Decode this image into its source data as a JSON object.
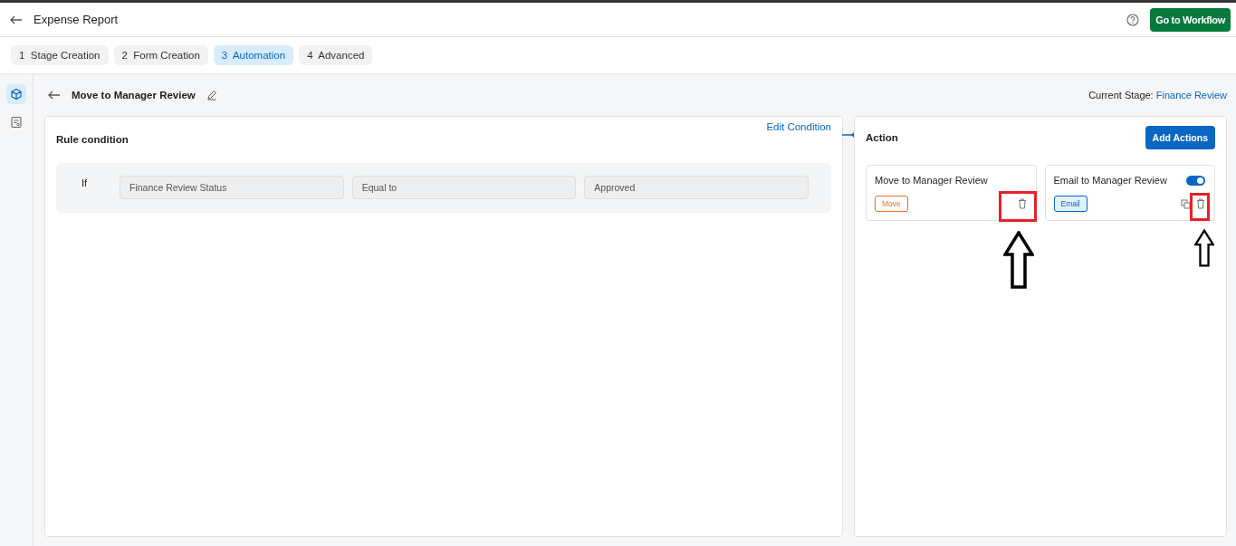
{
  "header": {
    "title": "Expense Report",
    "primary_button": "Go to Workflow"
  },
  "steps": [
    {
      "number": "1",
      "label": "Stage Creation",
      "selected": false
    },
    {
      "number": "2",
      "label": "Form Creation",
      "selected": false
    },
    {
      "number": "3",
      "label": "Automation",
      "selected": true
    },
    {
      "number": "4",
      "label": "Advanced",
      "selected": false
    }
  ],
  "sidebar": {
    "items": [
      {
        "kind": "cube",
        "selected": true
      },
      {
        "kind": "form",
        "selected": false
      }
    ]
  },
  "rule": {
    "title": "Move to Manager Review",
    "current_stage_label": "Current Stage:",
    "current_stage": "Finance Review"
  },
  "condition": {
    "title": "Rule condition",
    "edit_link": "Edit Condition",
    "keyword": "If",
    "fields": [
      "Finance Review Status",
      "Equal to",
      "Approved"
    ]
  },
  "actions": {
    "title": "Action",
    "add_button": "Add Actions",
    "items": [
      {
        "kind": "move",
        "title": "Move to Manager Review",
        "tag": "Move",
        "highlighted": true
      },
      {
        "kind": "email",
        "title": "Email to Manager Review",
        "tag": "Email",
        "enabled": true,
        "highlighted": true
      }
    ]
  }
}
